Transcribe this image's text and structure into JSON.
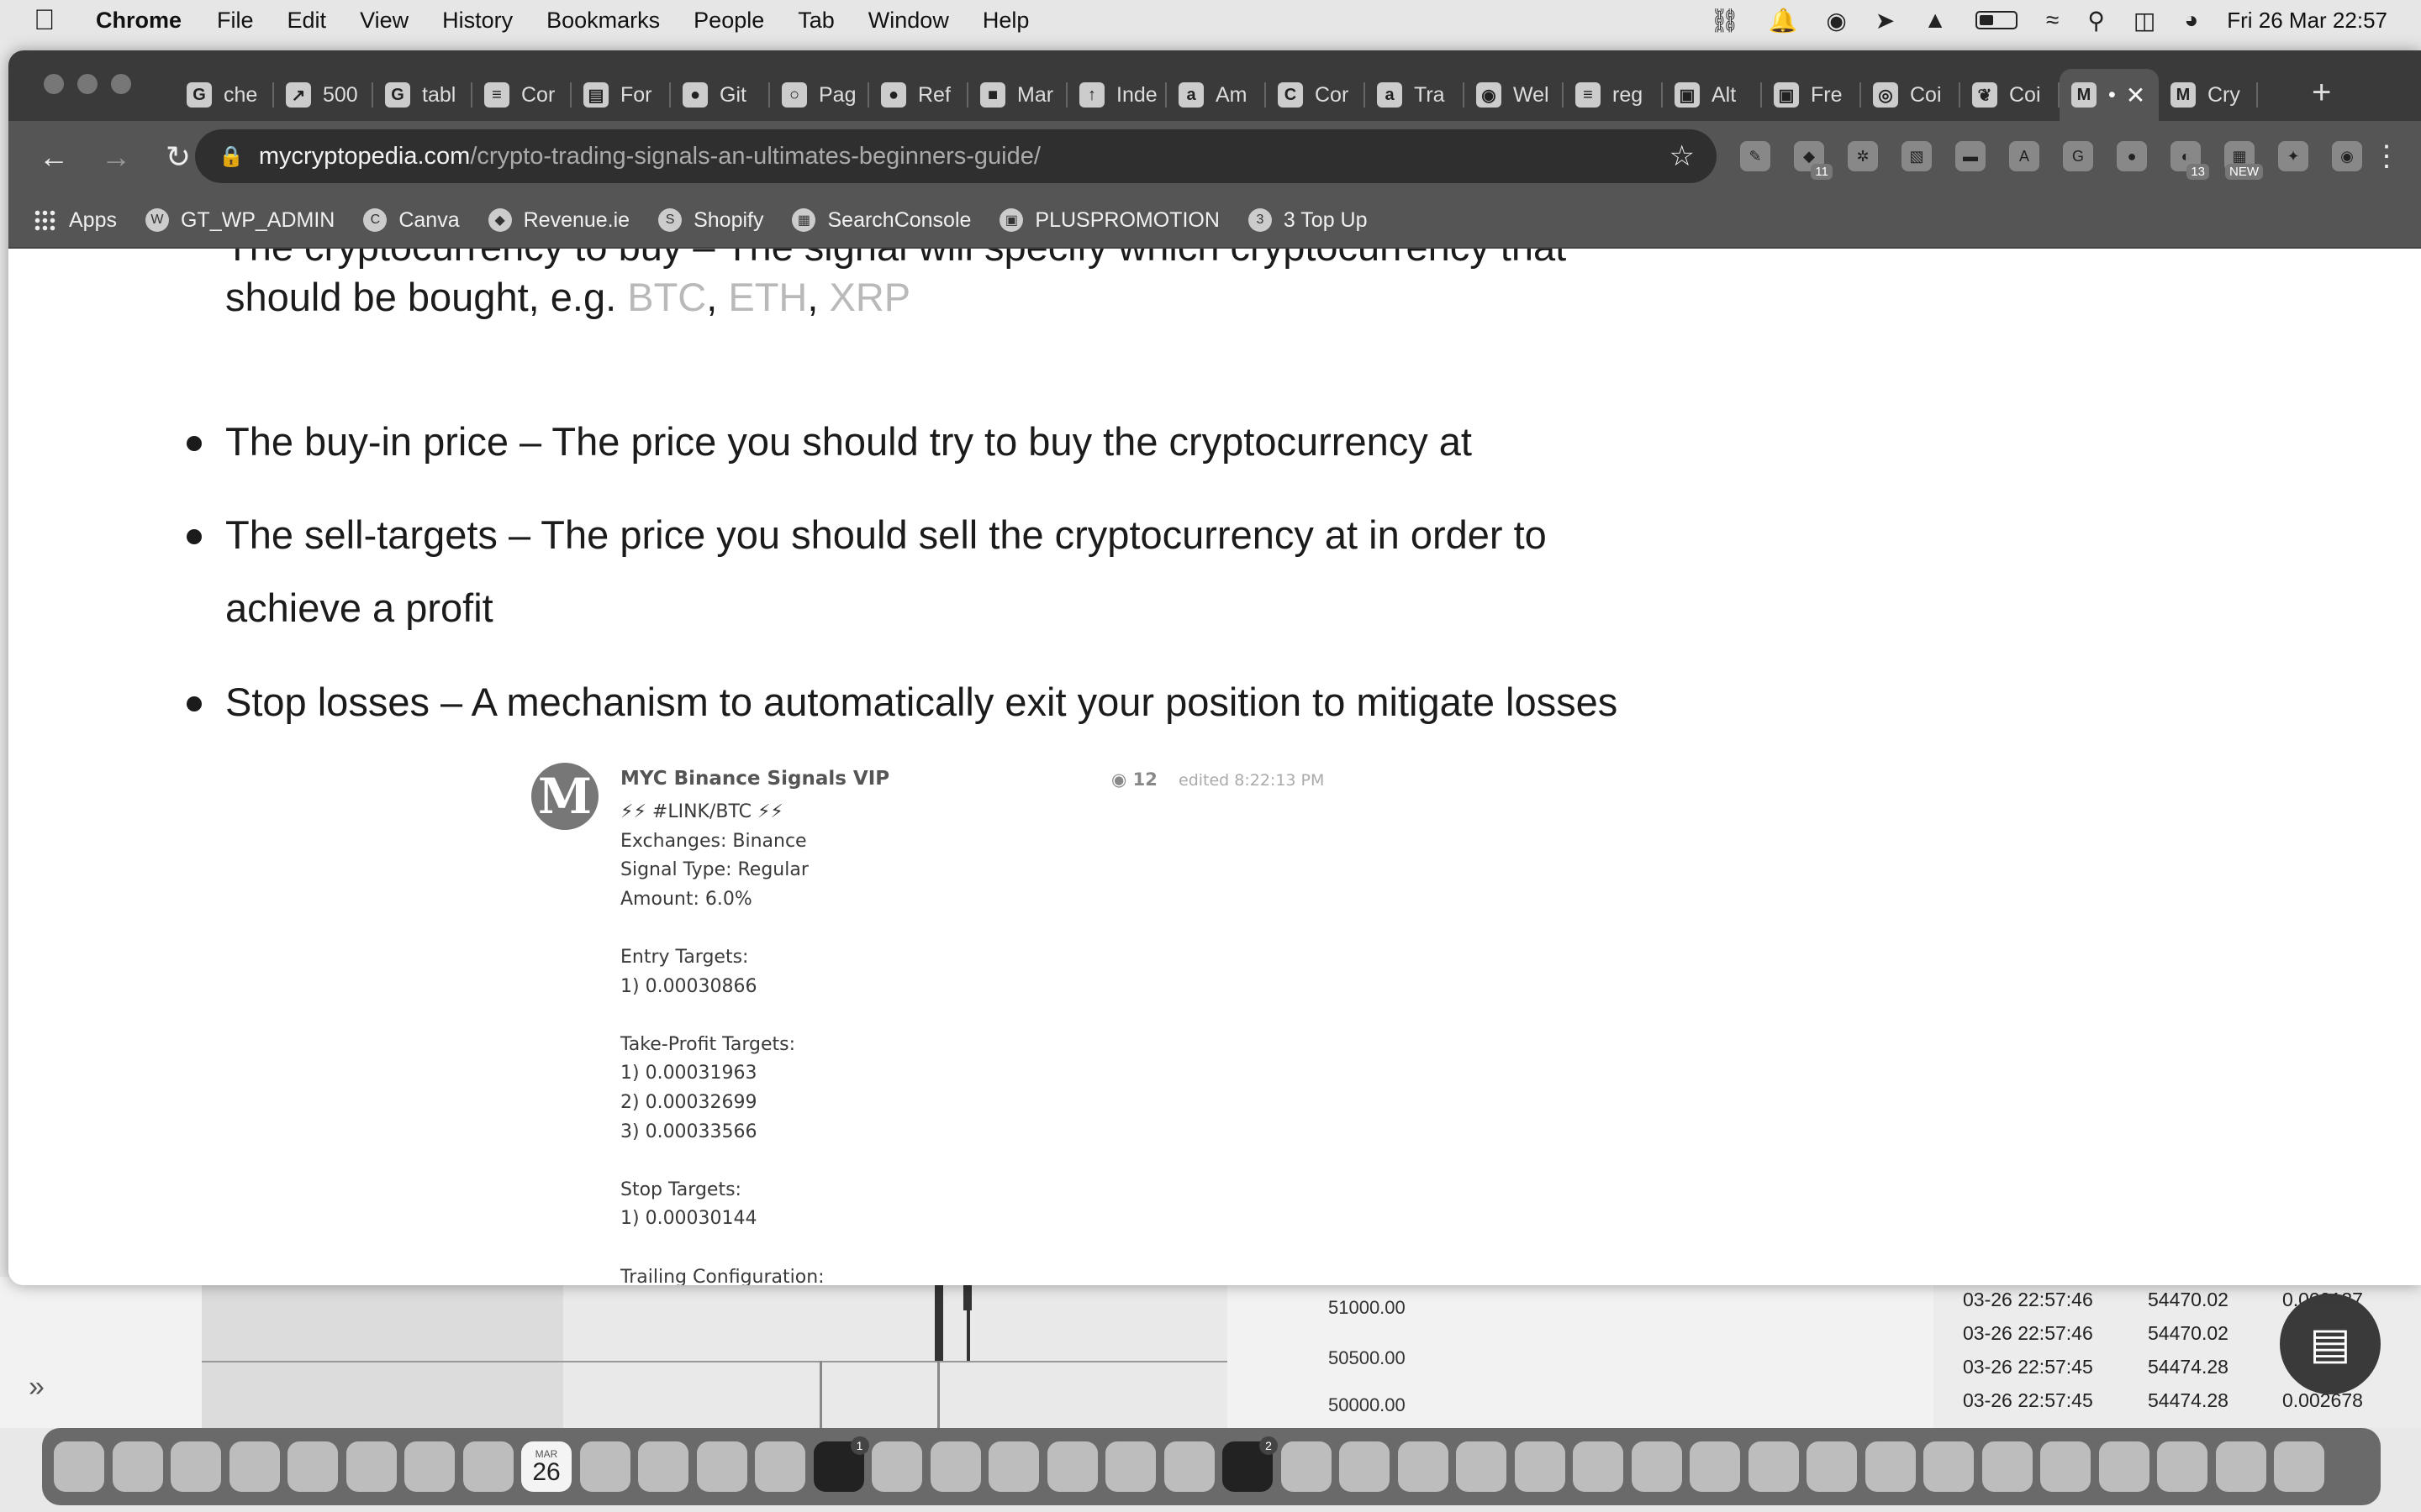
{
  "menubar": {
    "app_name": "Chrome",
    "items": [
      "File",
      "Edit",
      "View",
      "History",
      "Bookmarks",
      "People",
      "Tab",
      "Window",
      "Help"
    ],
    "clock": "Fri 26 Mar  22:57"
  },
  "tabs": [
    {
      "label": "che",
      "icon": "G"
    },
    {
      "label": "500",
      "icon": "↗"
    },
    {
      "label": "tabl",
      "icon": "G"
    },
    {
      "label": "Cor",
      "icon": "≡"
    },
    {
      "label": "For",
      "icon": "▤"
    },
    {
      "label": "Git",
      "icon": "●"
    },
    {
      "label": "Pag",
      "icon": "○"
    },
    {
      "label": "Ref",
      "icon": "●"
    },
    {
      "label": "Mar",
      "icon": "■"
    },
    {
      "label": "Inde",
      "icon": "↑"
    },
    {
      "label": "Am",
      "icon": "a"
    },
    {
      "label": "Cor",
      "icon": "C"
    },
    {
      "label": "Tra",
      "icon": "a"
    },
    {
      "label": "Wel",
      "icon": "◉"
    },
    {
      "label": "reg",
      "icon": "≡"
    },
    {
      "label": "Alt",
      "icon": "▣"
    },
    {
      "label": "Fre",
      "icon": "▣"
    },
    {
      "label": "Coi",
      "icon": "◎"
    },
    {
      "label": "Coi",
      "icon": "❦"
    },
    {
      "label": "•",
      "icon": "M",
      "active": true
    },
    {
      "label": "Cry",
      "icon": "M"
    }
  ],
  "omnibox": {
    "host": "mycryptopedia.com",
    "path": "/crypto-trading-signals-an-ultimates-beginners-guide/"
  },
  "extensions": [
    {
      "icon": "✎",
      "badge": ""
    },
    {
      "icon": "◆",
      "badge": "11"
    },
    {
      "icon": "✲",
      "badge": ""
    },
    {
      "icon": "▧",
      "badge": ""
    },
    {
      "icon": "▬",
      "badge": ""
    },
    {
      "icon": "A",
      "badge": ""
    },
    {
      "icon": "G",
      "badge": ""
    },
    {
      "icon": "●",
      "badge": ""
    },
    {
      "icon": "◐",
      "badge": "13"
    },
    {
      "icon": "▦",
      "badge": "NEW"
    },
    {
      "icon": "✦",
      "badge": ""
    },
    {
      "icon": "◉",
      "badge": ""
    }
  ],
  "bookmarks": [
    "Apps",
    "GT_WP_ADMIN",
    "Canva",
    "Revenue.ie",
    "Shopify",
    "SearchConsole",
    "PLUSPROMOTION",
    "3 Top Up"
  ],
  "article": {
    "partial_line": "The cryptocurrency to buy – The signal will specify which cryptocurrency that",
    "line1_prefix": "should be bought, e.g. ",
    "coins": [
      "BTC",
      "ETH",
      "XRP"
    ],
    "sep": ", ",
    "bullets": [
      "The buy-in price – The price you should try to buy the cryptocurrency at",
      "The sell-targets – The price you should sell the cryptocurrency at in order to",
      "achieve a profit",
      "Stop losses – A mechanism to automatically exit your position to mitigate losses"
    ]
  },
  "signal": {
    "channel": "MYC Binance Signals VIP",
    "views": "12",
    "edited": "edited 8:22:13 PM",
    "avatar_letter": "M",
    "body": "⚡⚡ #LINK/BTC ⚡⚡\nExchanges: Binance\nSignal Type: Regular\nAmount: 6.0%\n\nEntry Targets:\n1) 0.00030866\n\nTake-Profit Targets:\n1) 0.00031963\n2) 0.00032699\n3) 0.00033566\n\nStop Targets:\n1) 0.00030144\n\nTrailing Configuration:"
  },
  "background_app": {
    "axis_labels": [
      "51000.00",
      "50500.00",
      "50000.00"
    ],
    "trades": [
      {
        "time": "03-26 22:57:46",
        "price": "54470.02",
        "qty": "0.000137"
      },
      {
        "time": "03-26 22:57:46",
        "price": "54470.02",
        "qty": ""
      },
      {
        "time": "03-26 22:57:45",
        "price": "54474.28",
        "qty": ""
      },
      {
        "time": "03-26 22:57:45",
        "price": "54474.28",
        "qty": "0.002678"
      }
    ]
  },
  "dock": {
    "calendar_month": "MAR",
    "calendar_day": "26",
    "tv_badge": "1",
    "prefs_badge": "2"
  }
}
